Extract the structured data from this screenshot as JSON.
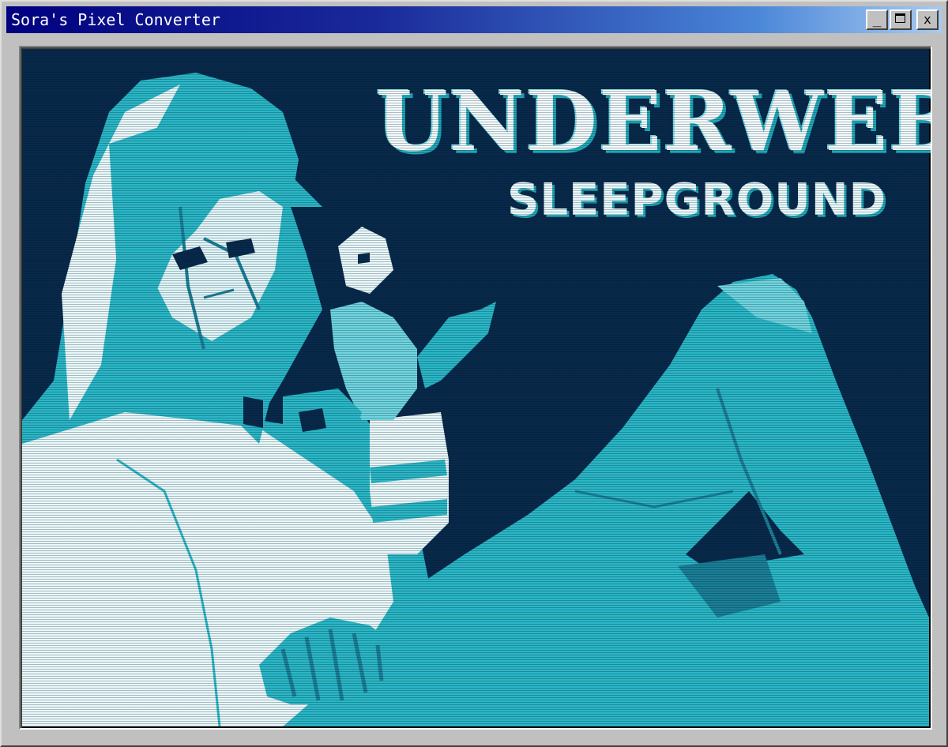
{
  "window": {
    "title": "Sora's Pixel Converter",
    "minimize_glyph": "_",
    "close_glyph": "x"
  },
  "artwork": {
    "logo_title": "UNDERWEB",
    "logo_subtitle": "SLEEPGROUND",
    "palette": {
      "background": "#08294a",
      "cyan": "#2ab7c6",
      "light": "#e9f8f9",
      "mid": "#1a7f96"
    }
  }
}
